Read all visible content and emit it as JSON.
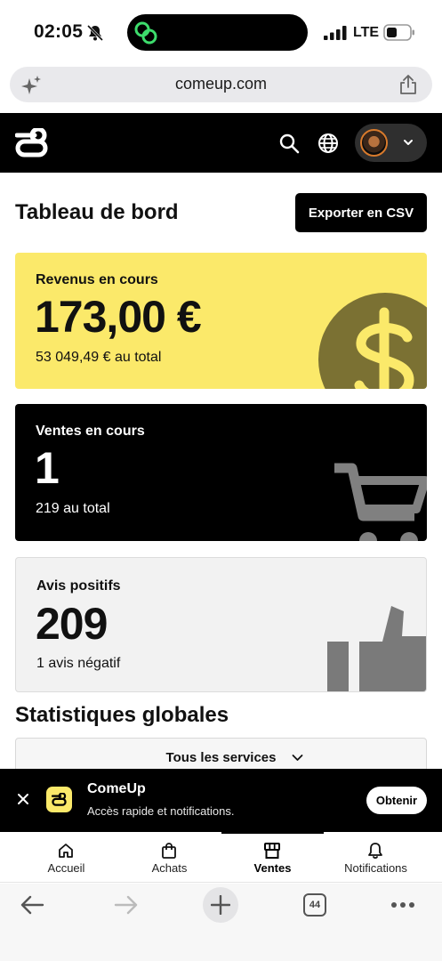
{
  "status_bar": {
    "time": "02:05",
    "network": "LTE"
  },
  "browser": {
    "url": "comeup.com",
    "tab_count": "44"
  },
  "dashboard": {
    "title": "Tableau de bord",
    "export_label": "Exporter en CSV",
    "cards": [
      {
        "label": "Revenus en cours",
        "value": "173,00 €",
        "sub": "53 049,49 € au total"
      },
      {
        "label": "Ventes en cours",
        "value": "1",
        "sub": "219 au total"
      },
      {
        "label": "Avis positifs",
        "value": "209",
        "sub": "1 avis négatif"
      }
    ],
    "stats_title": "Statistiques globales",
    "services_select": "Tous les services"
  },
  "app_banner": {
    "name": "ComeUp",
    "description": "Accès rapide et notifications.",
    "button": "Obtenir"
  },
  "bottom_nav": [
    {
      "label": "Accueil",
      "icon": "home-icon"
    },
    {
      "label": "Achats",
      "icon": "shopping-bag-icon"
    },
    {
      "label": "Ventes",
      "icon": "store-icon",
      "active": true
    },
    {
      "label": "Notifications",
      "icon": "bell-icon"
    }
  ],
  "colors": {
    "accent_yellow": "#fbe96a",
    "dark": "#000000",
    "coin": "#7b7133"
  }
}
